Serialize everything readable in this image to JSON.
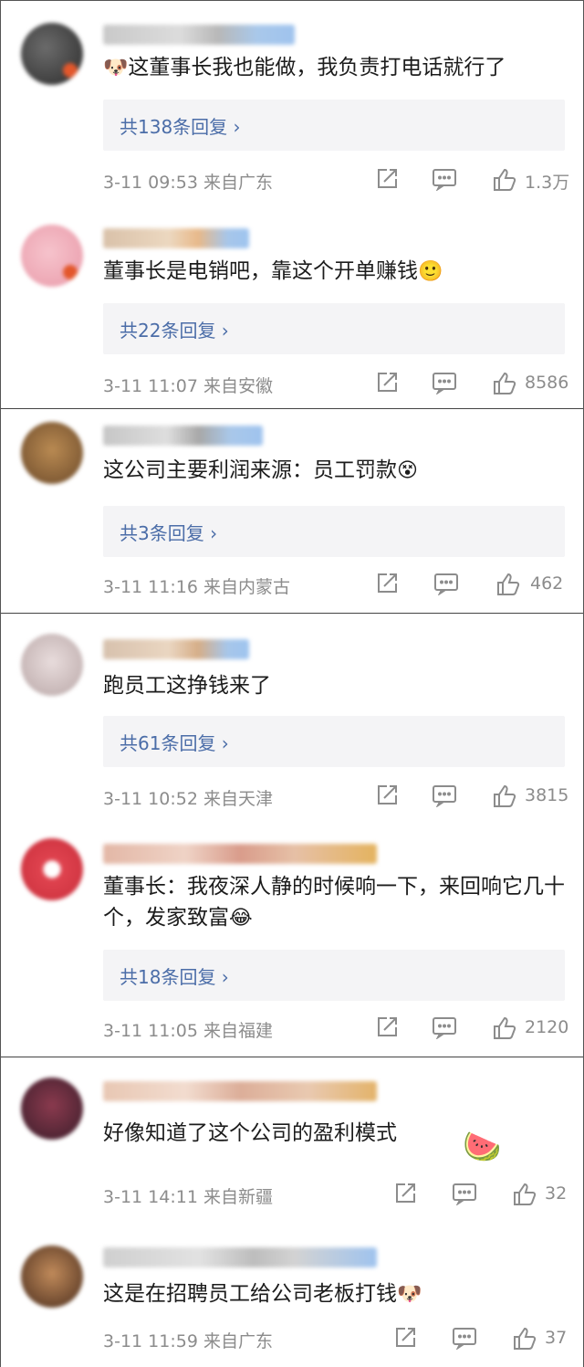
{
  "colors": {
    "reply_link": "#4b6da8",
    "meta_text": "#8c8c8c",
    "reply_bg": "#f4f4f6",
    "panel_border": "#444444"
  },
  "comments": [
    {
      "text": "这董事长我也能做，我负责打电话就行了",
      "emoji_before": "dog-face-emoji",
      "emoji_after": "",
      "replies": "共138条回复 ›",
      "time": "3-11 09:53",
      "location": "来自广东",
      "likes": "1.3万"
    },
    {
      "text": "董事长是电销吧，靠这个开单赚钱",
      "emoji_before": "",
      "emoji_after": "smile-emoji",
      "replies": "共22条回复 ›",
      "time": "3-11 11:07",
      "location": "来自安徽",
      "likes": "8586"
    },
    {
      "text": "这公司主要利润来源：员工罚款",
      "emoji_before": "",
      "emoji_after": "shocked-face-emoji",
      "replies": "共3条回复 ›",
      "time": "3-11 11:16",
      "location": "来自内蒙古",
      "likes": "462"
    },
    {
      "text": "跑员工这挣钱来了",
      "emoji_before": "",
      "emoji_after": "",
      "replies": "共61条回复 ›",
      "time": "3-11 10:52",
      "location": "来自天津",
      "likes": "3815"
    },
    {
      "text": "董事长：我夜深人静的时候响一下，来回响它几十个，发家致富",
      "emoji_before": "",
      "emoji_after": "laugh-cry-emoji",
      "replies": "共18条回复 ›",
      "time": "3-11 11:05",
      "location": "来自福建",
      "likes": "2120"
    },
    {
      "text": "好像知道了这个公司的盈利模式",
      "emoji_before": "",
      "emoji_after": "watermelon-emoji",
      "replies": "",
      "time": "3-11 14:11",
      "location": "来自新疆",
      "likes": "32"
    },
    {
      "text": "这是在招聘员工给公司老板打钱",
      "emoji_before": "",
      "emoji_after": "dog-face-emoji",
      "replies": "",
      "time": "3-11 11:59",
      "location": "来自广东",
      "likes": "37"
    }
  ]
}
